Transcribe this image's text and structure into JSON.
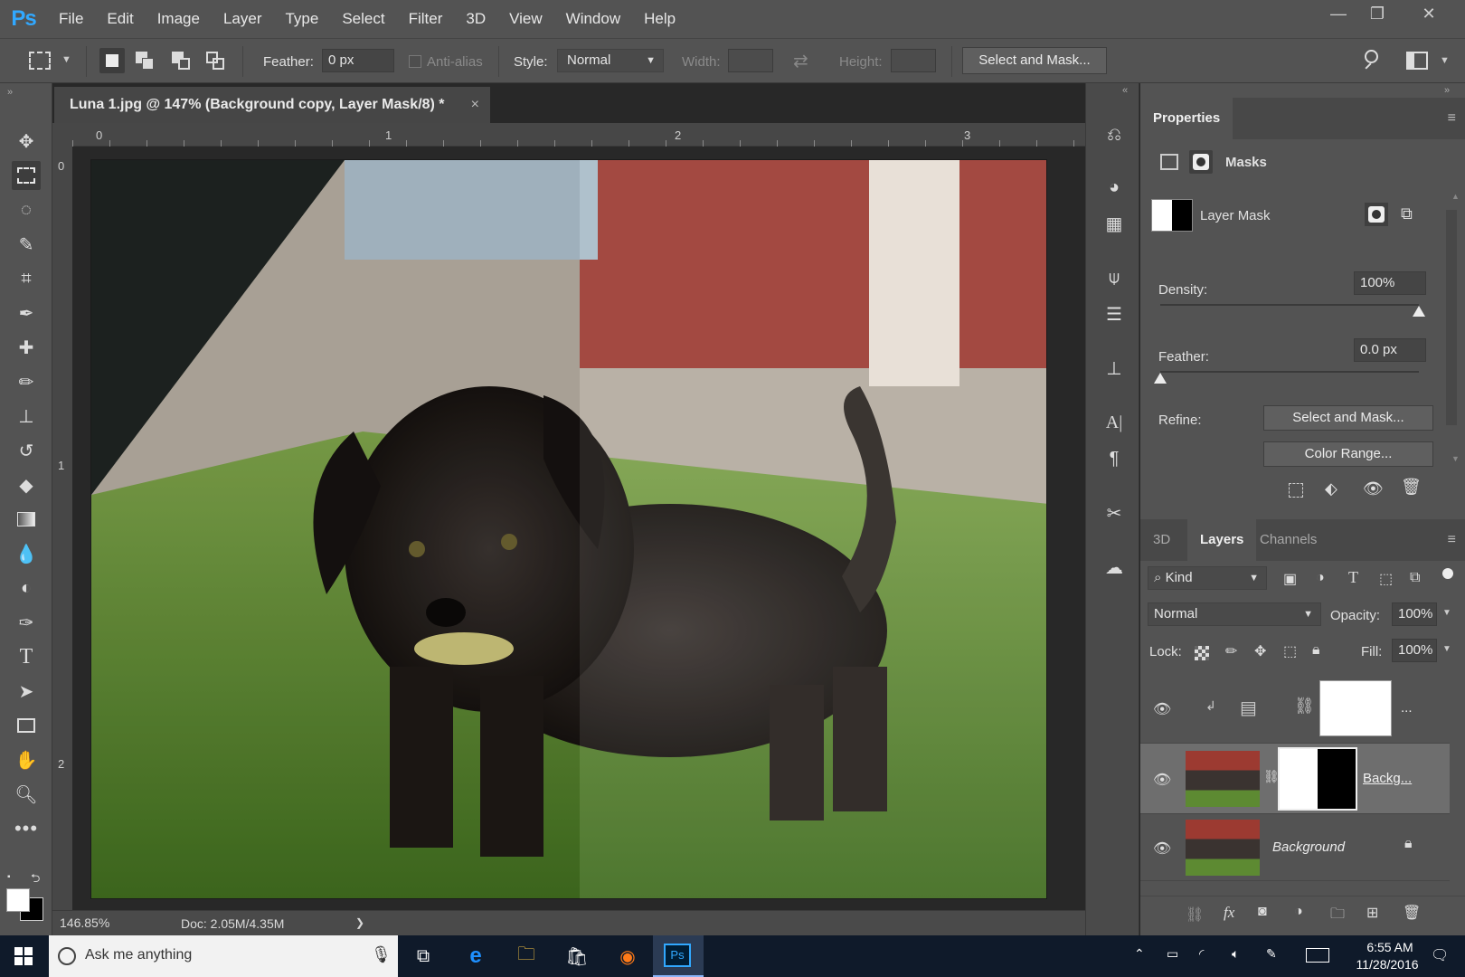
{
  "app": {
    "logo": "Ps",
    "menus": [
      "File",
      "Edit",
      "Image",
      "Layer",
      "Type",
      "Select",
      "Filter",
      "3D",
      "View",
      "Window",
      "Help"
    ],
    "window_controls": [
      "minimize-icon",
      "restore-icon",
      "close-icon"
    ]
  },
  "options": {
    "feather_label": "Feather:",
    "feather_value": "0 px",
    "antialias_label": "Anti-alias",
    "style_label": "Style:",
    "style_value": "Normal",
    "width_label": "Width:",
    "height_label": "Height:",
    "select_mask": "Select and Mask..."
  },
  "document": {
    "tab_title": "Luna 1.jpg @ 147% (Background copy, Layer Mask/8) *",
    "close": "×",
    "ruler_top": [
      "0",
      "1",
      "2",
      "3"
    ],
    "ruler_left": [
      "0",
      "1",
      "2"
    ]
  },
  "status": {
    "zoom": "146.85%",
    "doc": "Doc: 2.05M/4.35M",
    "arrow": "❯"
  },
  "properties": {
    "tab": "Properties",
    "section": "Masks",
    "layer_mask": "Layer Mask",
    "density_label": "Density:",
    "density_value": "100%",
    "density": 1.0,
    "feather_label": "Feather:",
    "feather_value": "0.0 px",
    "feather": 0.0,
    "refine_label": "Refine:",
    "select_mask": "Select and Mask...",
    "color_range": "Color Range..."
  },
  "layers": {
    "tabs": [
      "3D",
      "Layers",
      "Channels"
    ],
    "kind": "Kind",
    "blend": "Normal",
    "opacity_label": "Opacity:",
    "opacity_value": "100%",
    "lock_label": "Lock:",
    "fill_label": "Fill:",
    "fill_value": "100%",
    "rows": [
      {
        "name": "..."
      },
      {
        "name": "Backg..."
      },
      {
        "name": "Background"
      }
    ]
  },
  "taskbar": {
    "search": "Ask me anything",
    "time": "6:55 AM",
    "date": "11/28/2016"
  },
  "colors": {
    "accent": "#31a8ff",
    "panel": "#535353",
    "dark": "#282828"
  }
}
